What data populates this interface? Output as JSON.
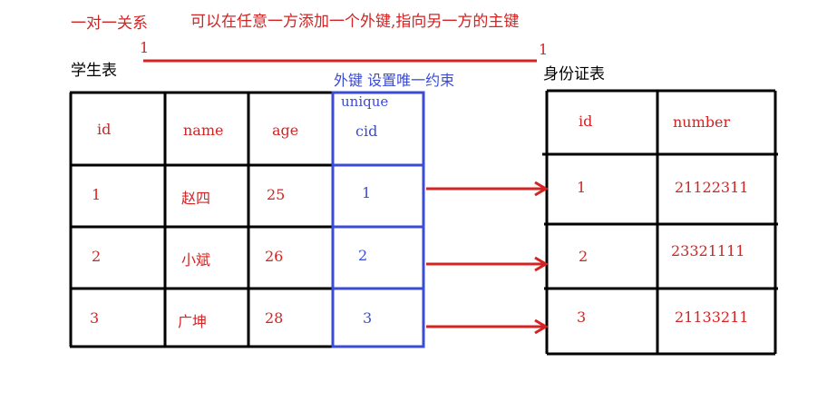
{
  "title": {
    "relation": "一对一关系",
    "note": "可以在任意一方添加一个外键,指向另一方的主键"
  },
  "cardinality": {
    "left": "1",
    "right": "1"
  },
  "student_table": {
    "label": "学生表",
    "headers": [
      "id",
      "name",
      "age"
    ],
    "rows": [
      [
        "1",
        "赵四",
        "25"
      ],
      [
        "2",
        "小斌",
        "26"
      ],
      [
        "3",
        "广坤",
        "28"
      ]
    ]
  },
  "foreign_key": {
    "label": "外键 设置唯一约束",
    "constraint": "unique",
    "column": "cid",
    "values": [
      "1",
      "2",
      "3"
    ]
  },
  "idcard_table": {
    "label": "身份证表",
    "headers": [
      "id",
      "number"
    ],
    "rows": [
      [
        "1",
        "21122311"
      ],
      [
        "2",
        "23321111"
      ],
      [
        "3",
        "21133211"
      ]
    ]
  },
  "colors": {
    "red": "#d42323",
    "blue": "#3a4bd6",
    "black": "#000000"
  }
}
